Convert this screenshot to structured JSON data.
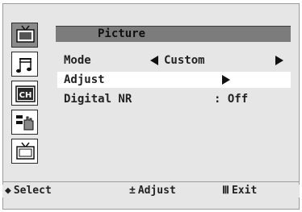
{
  "menu": {
    "title": "Picture",
    "side_icons": [
      "tv-picture-icon",
      "music-sound-icon",
      "channel-icon",
      "hand-setup-icon",
      "tv-input-icon"
    ],
    "active_icon": "tv-picture-icon",
    "rows": [
      {
        "label": "Mode",
        "value": "Custom",
        "has_left_arrow": true,
        "has_right_arrow": true,
        "selected": false
      },
      {
        "label": "Adjust",
        "value": "",
        "has_left_arrow": false,
        "has_right_arrow": true,
        "selected": true
      },
      {
        "label": "Digital NR",
        "value": ": Off",
        "has_left_arrow": false,
        "has_right_arrow": false,
        "selected": false
      }
    ],
    "ch_label": "CH"
  },
  "footer": {
    "select_icon": "◆",
    "select_label": "Select",
    "adjust_icon": "±",
    "adjust_label": "Adjust",
    "exit_icon": "Ⅲ",
    "exit_label": "Exit"
  }
}
